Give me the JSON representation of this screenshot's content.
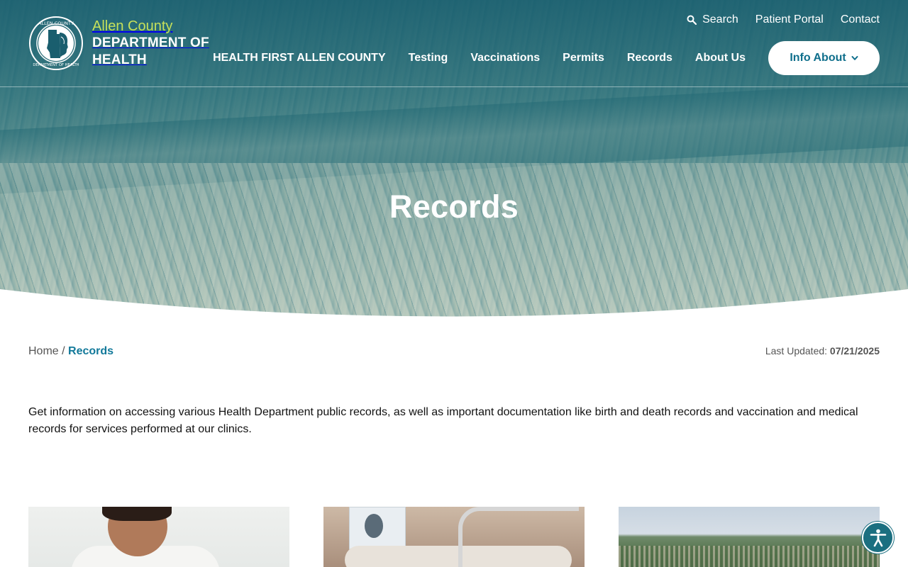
{
  "brand": {
    "county": "Allen County",
    "department": "DEPARTMENT OF HEALTH",
    "seal_text_top": "ALLEN COUNTY",
    "seal_text_bottom": "DEPARTMENT OF HEALTH",
    "accent_color": "#c6e05a"
  },
  "utility_nav": {
    "search": "Search",
    "search_icon": "search-icon",
    "patient_portal": "Patient Portal",
    "contact": "Contact"
  },
  "main_nav": {
    "items": [
      "HEALTH FIRST ALLEN COUNTY",
      "Testing",
      "Vaccinations",
      "Permits",
      "Records",
      "About Us"
    ],
    "info_button": "Info About",
    "info_button_icon": "chevron-down-icon"
  },
  "hero": {
    "title": "Records"
  },
  "breadcrumb": {
    "home": "Home",
    "separator": "/",
    "current": "Records"
  },
  "last_updated": {
    "label": "Last Updated:",
    "date": "07/21/2025"
  },
  "intro": "Get information on accessing various Health Department public records, as well as important documentation like birth and death records and vaccination and medical records for services performed at our clinics.",
  "accessibility": {
    "icon": "accessibility-icon",
    "color": "#1b6f80"
  }
}
